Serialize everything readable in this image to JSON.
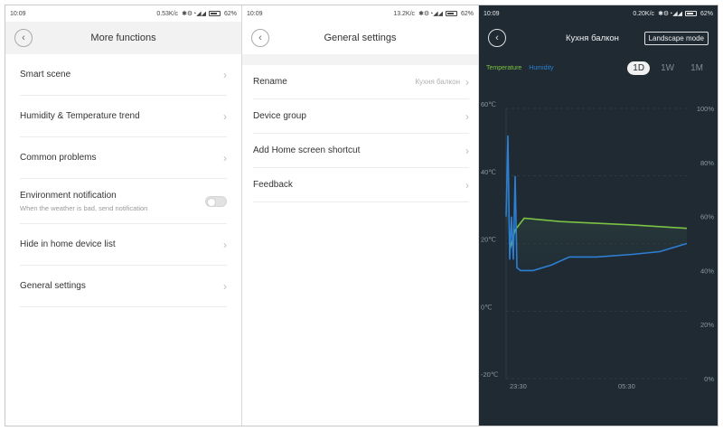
{
  "panel1": {
    "status": {
      "time": "10:09",
      "speed": "0.53K/c",
      "battery": "62%"
    },
    "header": {
      "title": "More functions"
    },
    "items": [
      {
        "label": "Smart scene"
      },
      {
        "label": "Humidity & Temperature trend"
      },
      {
        "label": "Common problems"
      },
      {
        "label": "Environment notification",
        "sub": "When the weather is bad, send notification",
        "toggle": false
      },
      {
        "label": "Hide in home device list"
      },
      {
        "label": "General settings"
      }
    ]
  },
  "panel2": {
    "status": {
      "time": "10:09",
      "speed": "13.2K/c",
      "battery": "62%"
    },
    "header": {
      "title": "General settings"
    },
    "items": [
      {
        "label": "Rename",
        "value": "Кухня балкон"
      },
      {
        "label": "Device group"
      },
      {
        "label": "Add Home screen shortcut"
      },
      {
        "label": "Feedback"
      }
    ]
  },
  "panel3": {
    "status": {
      "time": "10:09",
      "speed": "0.20K/c",
      "battery": "62%"
    },
    "header": {
      "title": "Кухня балкон",
      "landscape_label": "Landscape mode"
    },
    "legend": {
      "temperature": "Temperature",
      "humidity": "Humidity"
    },
    "ranges": [
      "1D",
      "1W",
      "1M"
    ],
    "selected_range": "1D",
    "colors": {
      "temperature": "#7cc243",
      "humidity": "#2d7fd3",
      "background": "#1f2a33"
    },
    "chart_data": {
      "type": "line",
      "x_ticks": [
        "23:30",
        "05:30"
      ],
      "y_left": {
        "ticks": [
          "60℃",
          "40℃",
          "20℃",
          "0℃",
          "-20℃"
        ],
        "min": -20,
        "max": 60
      },
      "y_right": {
        "ticks": [
          "100%",
          "80%",
          "60%",
          "40%",
          "20%",
          "0%"
        ],
        "min": 0,
        "max": 100
      },
      "series": [
        {
          "name": "Temperature",
          "axis": "left",
          "x": [
            0.02,
            0.05,
            0.1,
            0.3,
            0.5,
            0.7,
            0.85,
            1.0
          ],
          "values": [
            18,
            24,
            27.5,
            26.5,
            26,
            25.5,
            25,
            24.5
          ]
        },
        {
          "name": "Humidity",
          "axis": "right",
          "x": [
            0.0,
            0.01,
            0.02,
            0.03,
            0.04,
            0.05,
            0.06,
            0.08,
            0.15,
            0.25,
            0.35,
            0.5,
            0.7,
            0.85,
            0.95,
            1.0
          ],
          "values": [
            60,
            90,
            44,
            60,
            44,
            75,
            41,
            40,
            40,
            42,
            45,
            45,
            46,
            47,
            49,
            50
          ]
        }
      ]
    }
  }
}
